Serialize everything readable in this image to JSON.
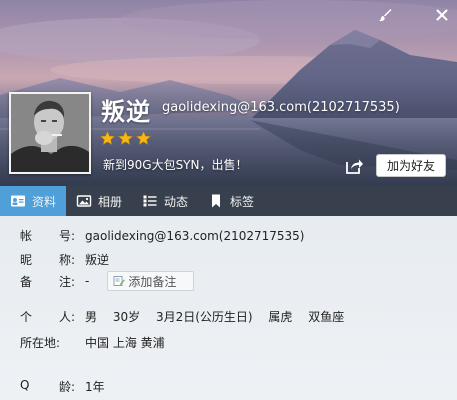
{
  "profile": {
    "nickname": "叛逆",
    "account": "gaolidexing@163.com(2102717535)",
    "stars": 3,
    "signature": "新到90G大包SYN，出售！",
    "add_friend_label": "加为好友"
  },
  "tabs": [
    {
      "label": "资料",
      "icon": "profile-card-icon",
      "active": true
    },
    {
      "label": "相册",
      "icon": "photo-album-icon",
      "active": false
    },
    {
      "label": "动态",
      "icon": "feed-list-icon",
      "active": false
    },
    {
      "label": "标签",
      "icon": "bookmark-tag-icon",
      "active": false
    }
  ],
  "details": {
    "account_label": "帐  号:",
    "account_label_a": "帐",
    "account_label_b": "号:",
    "account_value": "gaolidexing@163.com(2102717535)",
    "nickname_label_a": "昵",
    "nickname_label_b": "称:",
    "nickname_value": "叛逆",
    "remark_label_a": "备",
    "remark_label_b": "注:",
    "remark_value": "-",
    "remark_button": "添加备注",
    "personal_label_a": "个",
    "personal_label_b": "人:",
    "gender": "男",
    "age": "30岁",
    "birthday": "3月2日(公历生日)",
    "zodiac_animal": "属虎",
    "constellation": "双鱼座",
    "location_label": "所在地:",
    "location_value": "中国 上海 黄浦",
    "q_age_label_a": "Q",
    "q_age_label_b": "龄:",
    "q_age_value": "1年"
  },
  "colors": {
    "tabbar_bg": "#38404e",
    "tab_active": "#4f9fd8",
    "star": "#f5b81a"
  }
}
